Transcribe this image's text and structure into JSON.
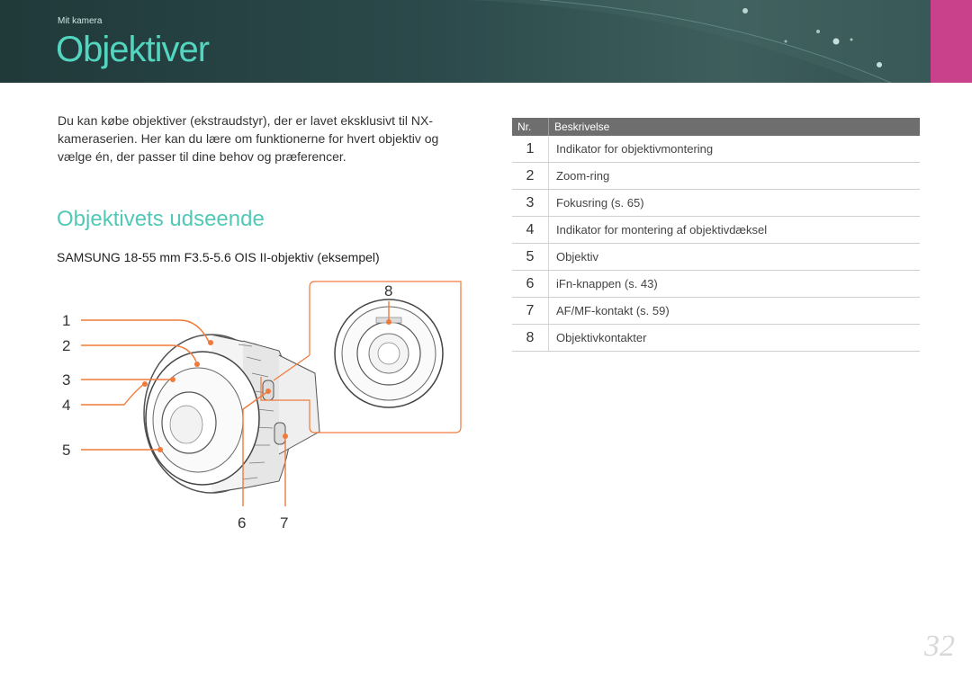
{
  "header": {
    "breadcrumb": "Mit kamera",
    "title": "Objektiver"
  },
  "intro": "Du kan købe objektiver (ekstraudstyr), der er lavet eksklusivt til NX-kameraserien. Her kan du lære om funktionerne for hvert objektiv og vælge én, der passer til dine behov og præferencer.",
  "section_title": "Objektivets udseende",
  "caption": "SAMSUNG 18-55 mm F3.5-5.6 OIS II-objektiv (eksempel)",
  "callouts": [
    "1",
    "2",
    "3",
    "4",
    "5",
    "6",
    "7",
    "8"
  ],
  "table": {
    "col_nr": "Nr.",
    "col_desc": "Beskrivelse",
    "rows": [
      {
        "nr": "1",
        "desc": "Indikator for objektivmontering"
      },
      {
        "nr": "2",
        "desc": "Zoom-ring"
      },
      {
        "nr": "3",
        "desc": "Fokusring (s. 65)"
      },
      {
        "nr": "4",
        "desc": "Indikator for montering af objektivdæksel"
      },
      {
        "nr": "5",
        "desc": "Objektiv"
      },
      {
        "nr": "6",
        "desc": "iFn-knappen (s. 43)"
      },
      {
        "nr": "7",
        "desc": "AF/MF-kontakt (s. 59)"
      },
      {
        "nr": "8",
        "desc": "Objektivkontakter"
      }
    ]
  },
  "page_number": "32",
  "colors": {
    "accent_teal": "#52d6bf",
    "header_bg": "#2c4a4b",
    "pink_tab": "#c9418a",
    "callout_orange": "#f07a3a"
  }
}
